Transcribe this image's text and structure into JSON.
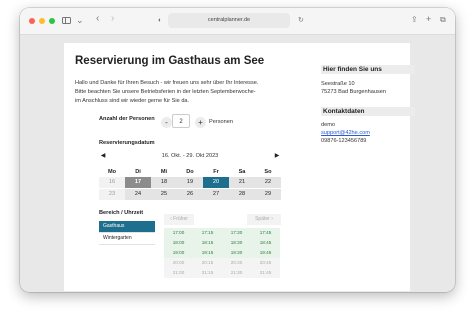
{
  "browser": {
    "address": "centralplanner.de"
  },
  "page": {
    "title": "Reservierung im Gasthaus am See",
    "intro_lines": [
      "Hallo und Danke für Ihren Besuch - wir freuen uns sehr über Ihr Interesse.",
      "Bitte beachten Sie unsere Betriebsferien in der letzten Septemberwoche-",
      "im Anschluss sind wir wieder gerne für Sie da."
    ],
    "persons": {
      "label": "Anzahl der Personen",
      "minus": "-",
      "value": "2",
      "plus": "+",
      "unit": "Personen"
    },
    "date": {
      "label": "Reservierungsdatum",
      "prev": "◀",
      "next": "▶",
      "range": "16. Okt. - 29. Okt 2023",
      "weekdays": [
        "Mo",
        "Di",
        "Mi",
        "Do",
        "Fr",
        "Sa",
        "So"
      ],
      "week1": [
        "16",
        "17",
        "18",
        "19",
        "20",
        "21",
        "22"
      ],
      "week2": [
        "23",
        "24",
        "25",
        "26",
        "27",
        "28",
        "29"
      ]
    },
    "area": {
      "label": "Bereich / Uhrzeit",
      "items": [
        "Gasthaus",
        "Wintergarten"
      ],
      "earlier": "‹ Früher",
      "later": "Später ›"
    },
    "times": [
      "17:00",
      "17:15",
      "17:30",
      "17:45",
      "18:00",
      "18:15",
      "18:30",
      "18:45",
      "19:00",
      "19:15",
      "19:30",
      "19:45",
      "20:00",
      "20:15",
      "20:30",
      "20:45",
      "21:00",
      "21:15",
      "21:30",
      "21:45"
    ]
  },
  "sidebar": {
    "find_title": "Hier finden Sie uns",
    "address1": "Seestraße 10",
    "address2": "75273 Bad Burgenhausen",
    "contact_title": "Kontaktdaten",
    "contact_name": "demo",
    "contact_email": "support@42he.com",
    "contact_phone": "09876-123456789"
  }
}
